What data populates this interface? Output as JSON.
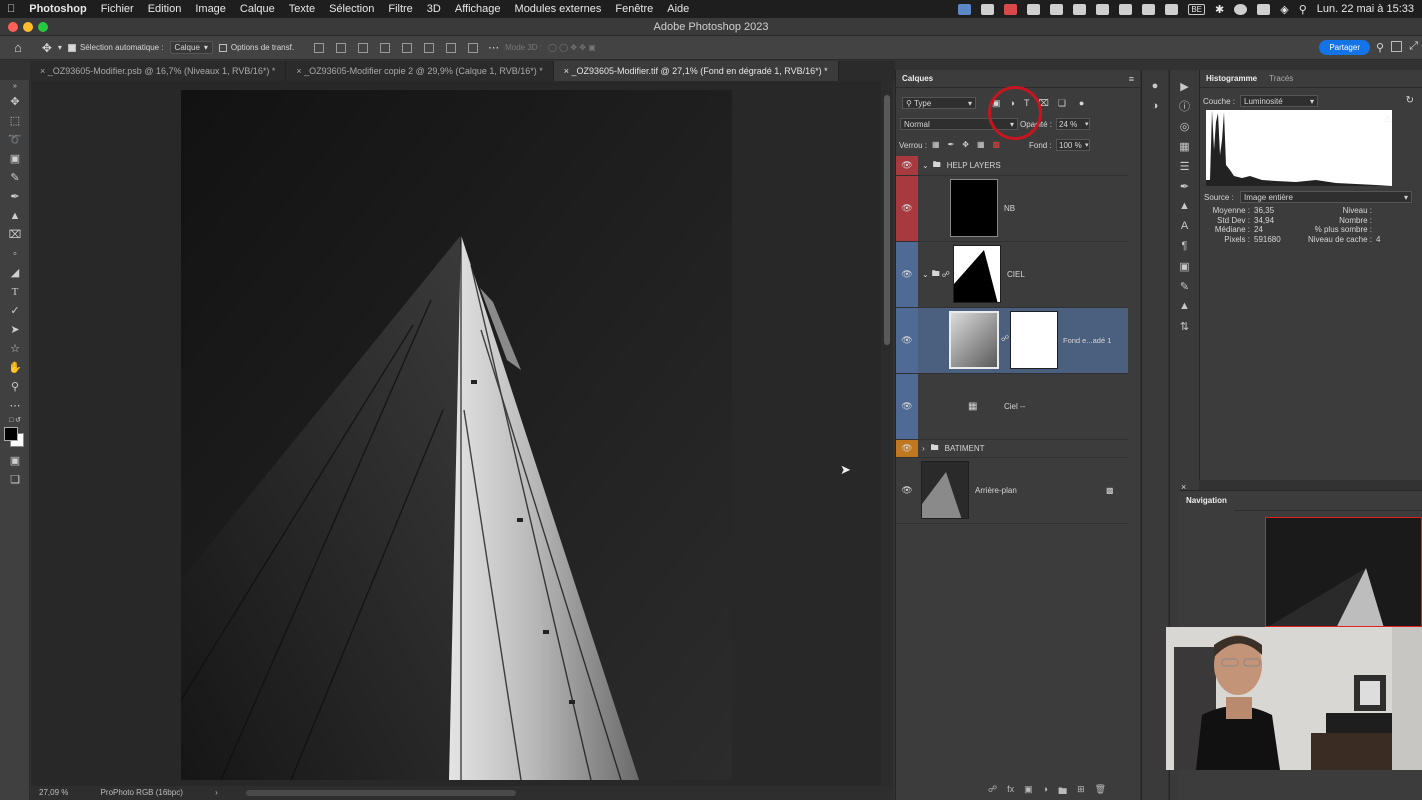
{
  "menubar": {
    "app": "Photoshop",
    "items": [
      "Fichier",
      "Edition",
      "Image",
      "Calque",
      "Texte",
      "Sélection",
      "Filtre",
      "3D",
      "Affichage",
      "Modules externes",
      "Fenêtre",
      "Aide"
    ],
    "badge": "BE",
    "clock": "Lun. 22 mai à 15:33"
  },
  "window": {
    "title": "Adobe Photoshop 2023"
  },
  "options": {
    "auto_select_label": "Sélection automatique :",
    "auto_select_value": "Calque",
    "transform_label": "Options de transf.",
    "mode3d": "Mode 3D :",
    "share": "Partager"
  },
  "tabs": [
    {
      "label": "_OZ93605-Modifier.psb @ 16,7% (Niveaux 1, RVB/16*) *"
    },
    {
      "label": "_OZ93605-Modifier copie 2 @ 29,9% (Calque 1, RVB/16*) *"
    },
    {
      "label": "_OZ93605-Modifier.tif @ 27,1% (Fond en dégradé 1, RVB/16*) *"
    }
  ],
  "footer": {
    "zoom": "27,09 %",
    "profile": "ProPhoto RGB (16bpc)"
  },
  "layers": {
    "title": "Calques",
    "filter": "Type",
    "blend": "Normal",
    "opacity_label": "Opacité :",
    "opacity_value": "24 %",
    "lock_label": "Verrou :",
    "fill_label": "Fond :",
    "fill_value": "100 %",
    "rows": [
      {
        "name": "HELP LAYERS"
      },
      {
        "name": "NB"
      },
      {
        "name": "CIEL"
      },
      {
        "name": "Fond e...adé 1"
      },
      {
        "name": "Ciel --"
      },
      {
        "name": "BATIMENT"
      },
      {
        "name": "Arrière-plan"
      }
    ],
    "colors": {
      "red": "#a7393f",
      "blue": "#4f6a94",
      "orange": "#c07820",
      "selected": "#4b5f7e"
    }
  },
  "histogram": {
    "tabs": [
      "Histogramme",
      "Tracés"
    ],
    "channel_label": "Couche :",
    "channel_value": "Luminosité",
    "source_label": "Source :",
    "source_value": "Image entière",
    "stats_left": [
      [
        "Moyenne :",
        "36,35"
      ],
      [
        "Std Dev :",
        "34,94"
      ],
      [
        "Médiane :",
        "24"
      ],
      [
        "Pixels :",
        "591680"
      ]
    ],
    "stats_right": [
      [
        "Niveau :",
        ""
      ],
      [
        "Nombre :",
        ""
      ],
      [
        "% plus sombre :",
        ""
      ],
      [
        "Niveau de cache :",
        "4"
      ]
    ]
  },
  "navigator": {
    "title": "Navigation"
  }
}
